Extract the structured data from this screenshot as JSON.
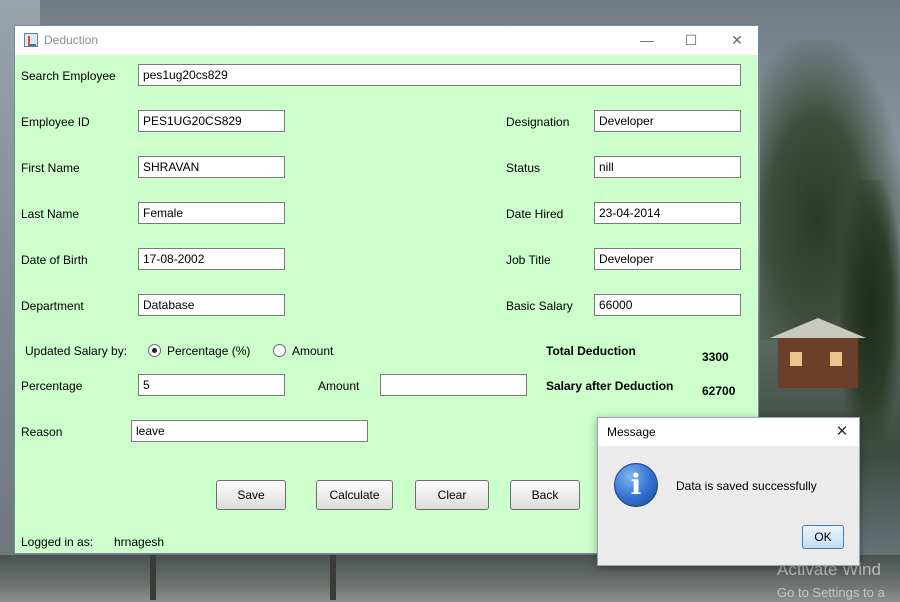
{
  "window": {
    "title": "Deduction"
  },
  "search": {
    "label": "Search Employee",
    "value": "pes1ug20cs829"
  },
  "form": {
    "employee_id": {
      "label": "Employee ID",
      "value": "PES1UG20CS829"
    },
    "first_name": {
      "label": "First Name",
      "value": "SHRAVAN"
    },
    "last_name": {
      "label": "Last Name",
      "value": "Female"
    },
    "dob": {
      "label": "Date of Birth",
      "value": "17-08-2002"
    },
    "department": {
      "label": "Department",
      "value": "Database"
    },
    "designation": {
      "label": "Designation",
      "value": "Developer"
    },
    "status": {
      "label": "Status",
      "value": "nill"
    },
    "date_hired": {
      "label": "Date Hired",
      "value": "23-04-2014"
    },
    "job_title": {
      "label": "Job Title",
      "value": "Developer"
    },
    "basic_salary": {
      "label": "Basic Salary",
      "value": "66000"
    }
  },
  "update": {
    "label": "Updated Salary by:",
    "option_percentage": "Percentage (%)",
    "option_amount": "Amount",
    "selected": "percentage"
  },
  "percentage": {
    "label": "Percentage",
    "value": "5"
  },
  "amount": {
    "label": "Amount",
    "value": ""
  },
  "reason": {
    "label": "Reason",
    "value": "leave"
  },
  "totals": {
    "total_deduction_label": "Total Deduction",
    "total_deduction_value": "3300",
    "salary_after_label": "Salary after Deduction",
    "salary_after_value": "62700"
  },
  "buttons": {
    "save": "Save",
    "calculate": "Calculate",
    "clear": "Clear",
    "back": "Back"
  },
  "footer": {
    "logged_label": "Logged in as:",
    "user": "hrnagesh"
  },
  "dialog": {
    "title": "Message",
    "message": "Data is saved successfully",
    "ok": "OK"
  },
  "watermark": {
    "line1": "Activate Wind",
    "line2": "Go to Settings to a"
  }
}
